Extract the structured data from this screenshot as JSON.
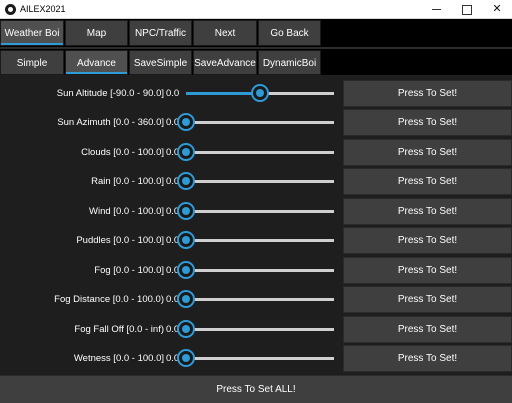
{
  "window": {
    "title": "AILEX2021",
    "minimize_glyph": "",
    "maximize_glyph": "",
    "close_glyph": "✕"
  },
  "tabs_primary": [
    {
      "label": "Weather Boi",
      "active": true
    },
    {
      "label": "Map",
      "active": false
    },
    {
      "label": "NPC/Traffic",
      "active": false
    },
    {
      "label": "Next",
      "active": false
    },
    {
      "label": "Go Back",
      "active": false
    }
  ],
  "tabs_secondary": [
    {
      "label": "Simple",
      "active": false
    },
    {
      "label": "Advance",
      "active": true
    },
    {
      "label": "SaveSimple",
      "active": false
    },
    {
      "label": "SaveAdvance",
      "active": false
    },
    {
      "label": "DynamicBoi",
      "active": false
    }
  ],
  "parameters": [
    {
      "label": "Sun Altitude [-90.0 - 90.0]",
      "value": "0.0",
      "fraction": 0.5,
      "button": "Press To Set!"
    },
    {
      "label": "Sun Azimuth [0.0 - 360.0]",
      "value": "0.0",
      "fraction": 0,
      "button": "Press To Set!"
    },
    {
      "label": "Clouds [0.0 - 100.0]",
      "value": "0.0",
      "fraction": 0,
      "button": "Press To Set!"
    },
    {
      "label": "Rain [0.0 - 100.0]",
      "value": "0.0",
      "fraction": 0,
      "button": "Press To Set!"
    },
    {
      "label": "Wind [0.0 - 100.0]",
      "value": "0.0",
      "fraction": 0,
      "button": "Press To Set!"
    },
    {
      "label": "Puddles [0.0 - 100.0]",
      "value": "0.0",
      "fraction": 0,
      "button": "Press To Set!"
    },
    {
      "label": "Fog [0.0 - 100.0]",
      "value": "0.0",
      "fraction": 0,
      "button": "Press To Set!"
    },
    {
      "label": "Fog Distance [0.0 - 100.0)",
      "value": "0.0",
      "fraction": 0,
      "button": "Press To Set!"
    },
    {
      "label": "Fog Fall Off [0.0 - inf)",
      "value": "0.0",
      "fraction": 0,
      "button": "Press To Set!"
    },
    {
      "label": "Wetness [0.0 - 100.0]",
      "value": "0.0",
      "fraction": 0,
      "button": "Press To Set!"
    }
  ],
  "set_all_label": "Press To Set ALL!",
  "colors": {
    "accent": "#2e9ad6",
    "background": "#1e1e1e",
    "button": "#3f3f3f",
    "tab_bar": "#000000"
  }
}
